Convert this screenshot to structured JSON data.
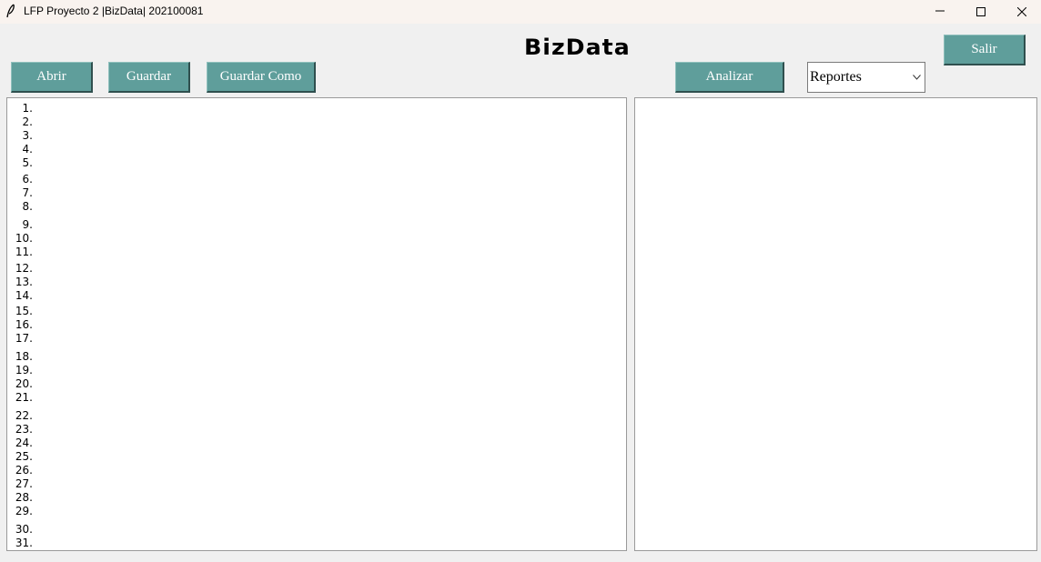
{
  "window": {
    "title": "LFP Proyecto 2 |BizData| 202100081",
    "icon": "feather-icon"
  },
  "header": {
    "title": "BizData"
  },
  "toolbar": {
    "open_label": "Abrir",
    "save_label": "Guardar",
    "save_as_label": "Guardar Como",
    "analyze_label": "Analizar",
    "exit_label": "Salir",
    "reports_select": {
      "selected": "Reportes"
    }
  },
  "editor": {
    "line_numbers": [
      "1.",
      "2.",
      "3.",
      "4.",
      "5.",
      "6.",
      "7.",
      "8.",
      "9.",
      "10.",
      "11.",
      "12.",
      "13.",
      "14.",
      "15.",
      "16.",
      "17.",
      "18.",
      "19.",
      "20.",
      "21.",
      "22.",
      "23.",
      "24.",
      "25.",
      "26.",
      "27.",
      "28.",
      "29.",
      "30.",
      "31."
    ],
    "content": ""
  },
  "output": {
    "content": ""
  },
  "colors": {
    "button_bg": "#5f9e9b",
    "button_text": "#ffffff",
    "window_bg": "#f0f0f0",
    "titlebar_bg": "#f9f3ef"
  }
}
